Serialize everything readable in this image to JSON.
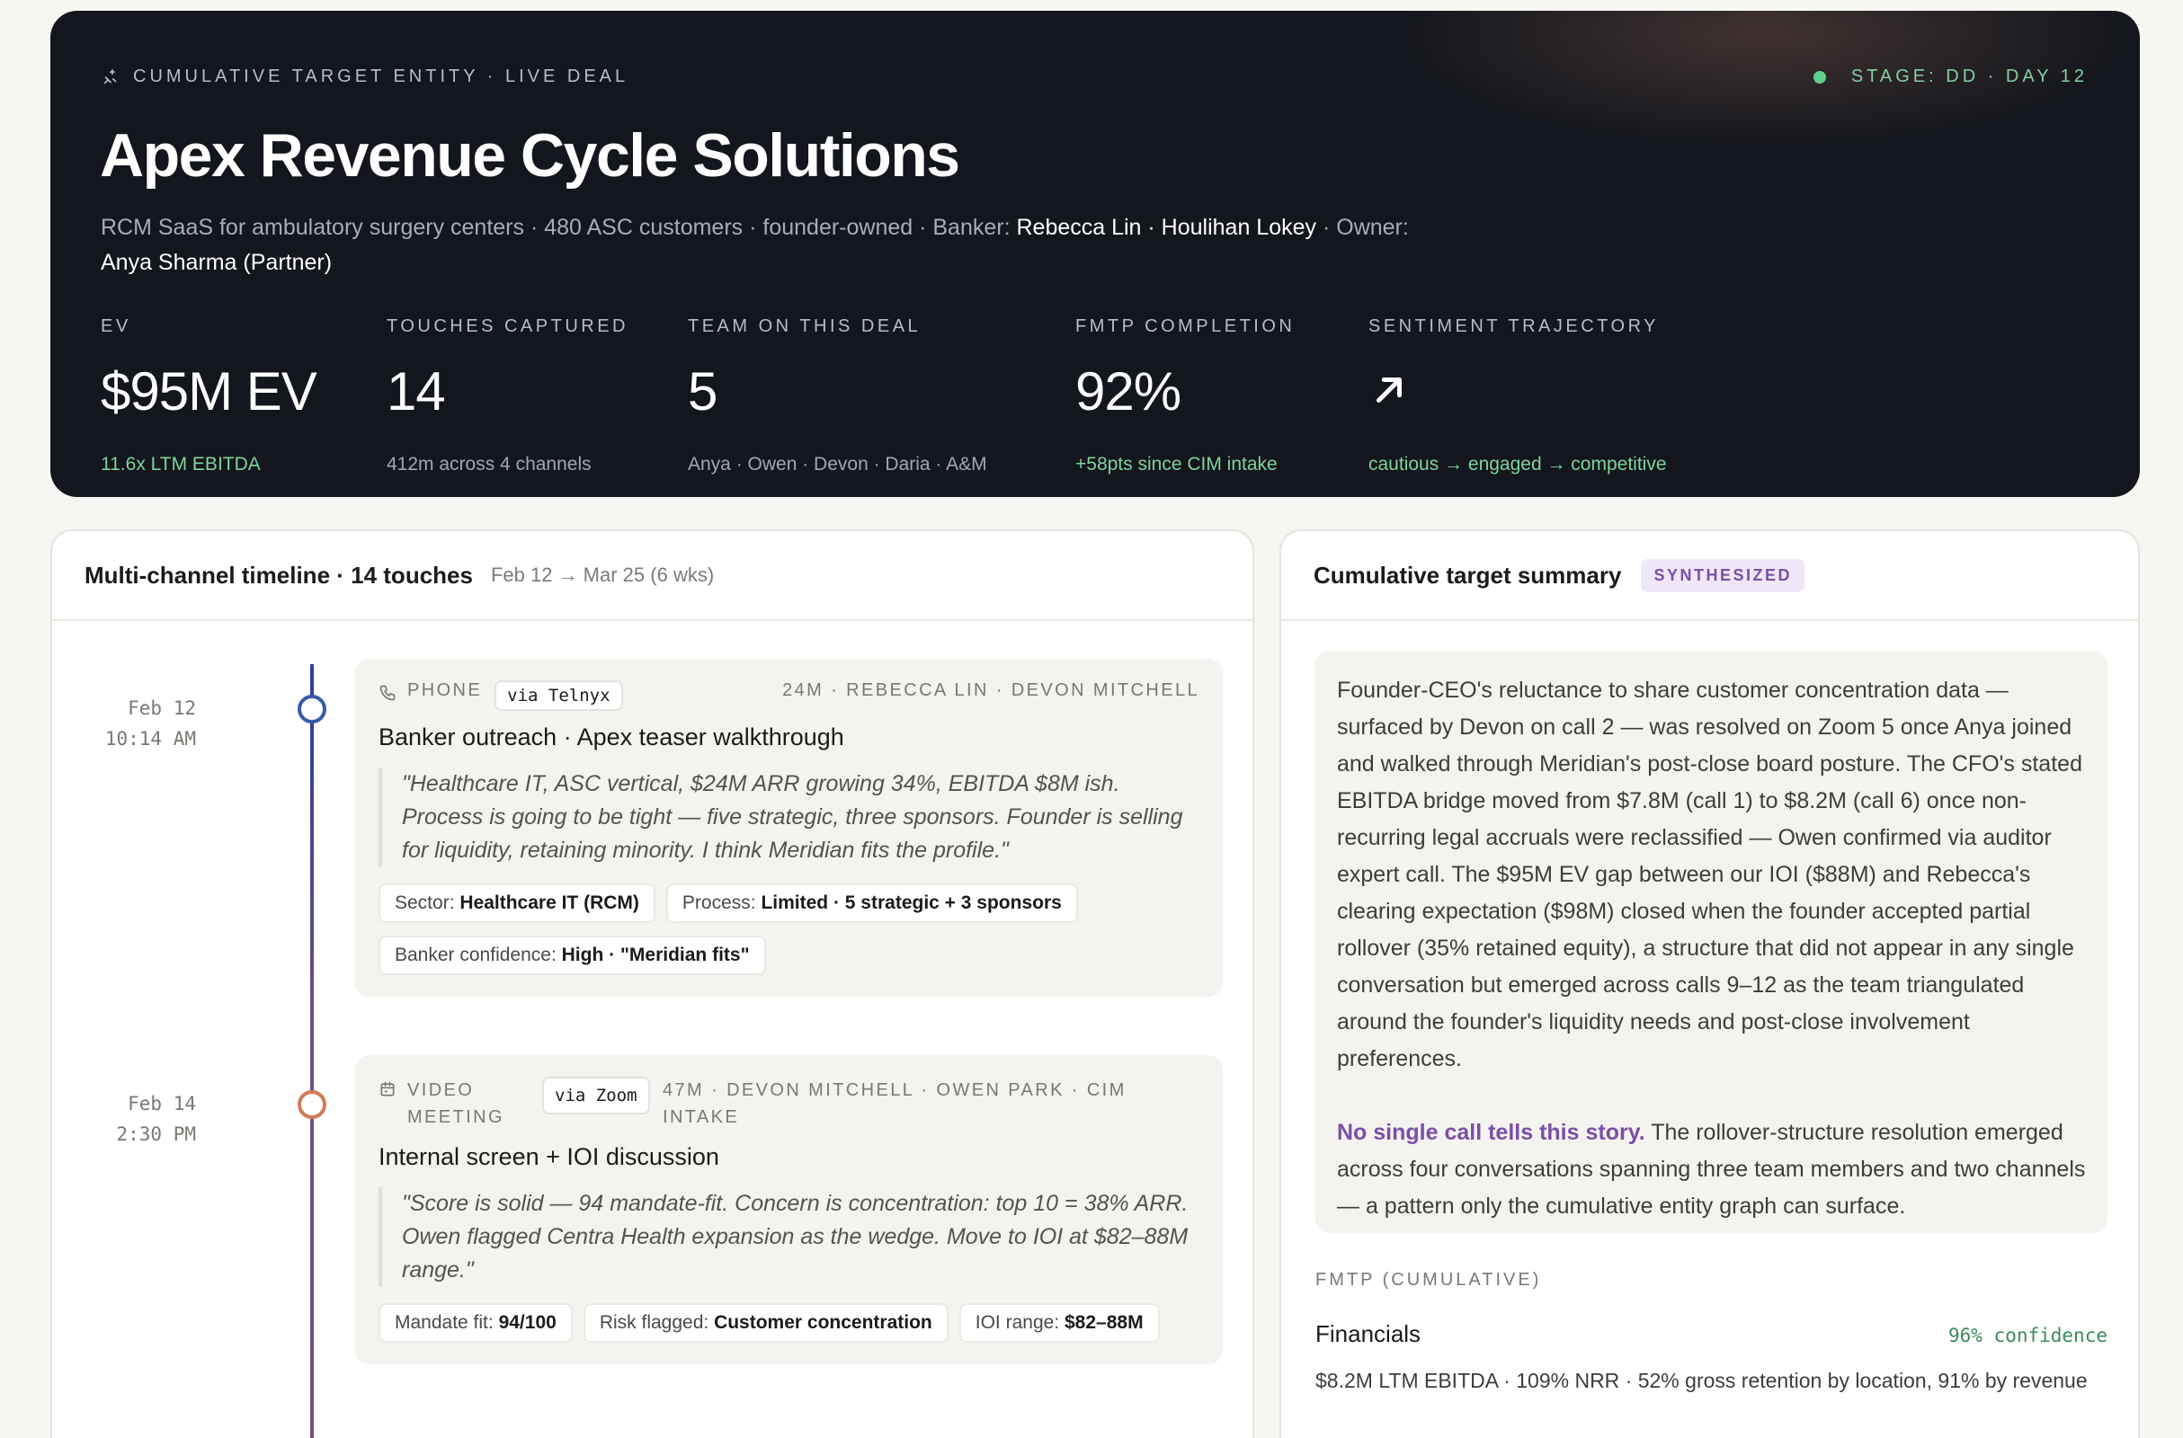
{
  "hero": {
    "eyebrow": "Cumulative target entity · Live deal",
    "stage": "Stage: DD · Day 12",
    "title": "Apex Revenue Cycle Solutions",
    "subtitle_pre": "RCM SaaS for ambulatory surgery centers · 480 ASC customers · founder-owned · Banker: ",
    "banker": "Rebecca Lin · Houlihan Lokey",
    "owner_label": " · Owner: ",
    "owner": "Anya Sharma (Partner)",
    "metrics": [
      {
        "label": "EV",
        "value": "$95M EV",
        "note": "11.6x LTM EBITDA"
      },
      {
        "label": "Touches captured",
        "value": "14",
        "note": "412m across 4 channels"
      },
      {
        "label": "Team on this deal",
        "value": "5",
        "note": "Anya · Owen · Devon · Daria · A&M"
      },
      {
        "label": "FMTP completion",
        "value": "92%",
        "note": "+58pts since CIM intake"
      },
      {
        "label": "Sentiment trajectory",
        "icon": "arrow-up-right-icon",
        "note": "cautious → engaged → competitive"
      }
    ]
  },
  "timeline": {
    "title": "Multi-channel timeline · 14 touches",
    "range": "Feb 12 → Mar 25 (6 wks)",
    "touches": [
      {
        "date": "Feb 12",
        "time": "10:14 AM",
        "channel": "Phone",
        "channel_icon": "phone-icon",
        "via": "via Telnyx",
        "meta": "24m · Rebecca Lin · Devon Mitchell",
        "title": "Banker outreach · Apex teaser walkthrough",
        "quote": "\"Healthcare IT, ASC vertical, $24M ARR growing 34%, EBITDA $8M ish. Process is going to be tight — five strategic, three sponsors. Founder is selling for liquidity, retaining minority. I think Meridian fits the profile.\"",
        "tags": [
          {
            "k": "Sector:",
            "v": "Healthcare IT (RCM)"
          },
          {
            "k": "Process:",
            "v": "Limited · 5 strategic + 3 sponsors"
          },
          {
            "k": "Banker confidence:",
            "v": "High · \"Meridian fits\""
          }
        ]
      },
      {
        "date": "Feb 14",
        "time": "2:30 PM",
        "channel": "Video meeting",
        "channel_icon": "calendar-icon",
        "via": "via Zoom",
        "meta": "47m · Devon Mitchell · Owen Park · CIM intake",
        "title": "Internal screen + IOI discussion",
        "quote": "\"Score is solid — 94 mandate-fit. Concern is concentration: top 10 = 38% ARR. Owen flagged Centra Health expansion as the wedge. Move to IOI at $82–88M range.\"",
        "tags": [
          {
            "k": "Mandate fit:",
            "v": "94/100"
          },
          {
            "k": "Risk flagged:",
            "v": "Customer concentration"
          },
          {
            "k": "IOI range:",
            "v": "$82–88M"
          }
        ]
      }
    ]
  },
  "summary": {
    "title": "Cumulative target summary",
    "badge": "SYNTHESIZED",
    "para1": "Founder-CEO's reluctance to share customer concentration data — surfaced by Devon on call 2 — was resolved on Zoom 5 once Anya joined and walked through Meridian's post-close board posture. The CFO's stated EBITDA bridge moved from $7.8M (call 1) to $8.2M (call 6) once non-recurring legal accruals were reclassified — Owen confirmed via auditor expert call. The $95M EV gap between our IOI ($88M) and Rebecca's clearing expectation ($98M) closed when the founder accepted partial rollover (35% retained equity), a structure that did not appear in any single conversation but emerged across calls 9–12 as the team triangulated around the founder's liquidity needs and post-close involvement preferences.",
    "para2_em": "No single call tells this story.",
    "para2_rest": " The rollover-structure resolution emerged across four conversations spanning three team members and two channels — a pattern only the cumulative entity graph can surface.",
    "fmtp_label": "FMTP (cumulative)",
    "financials": {
      "title": "Financials",
      "confidence": "96% confidence",
      "detail": "$8.2M LTM EBITDA · 109% NRR · 52% gross retention by location, 91% by revenue"
    }
  }
}
